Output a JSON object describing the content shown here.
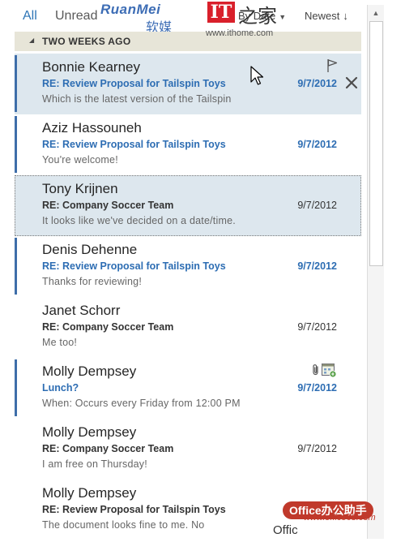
{
  "filters": {
    "all": "All",
    "unread": "Unread"
  },
  "sort": {
    "field": "By Date",
    "order": "Newest"
  },
  "group": {
    "label": "TWO WEEKS AGO"
  },
  "watermarks": {
    "ruanmei_en": "RuanMei",
    "ruanmei_cn": "软媒",
    "it_logo": "IT",
    "it_cn": "之家",
    "ithome_url": "www.ithome.com",
    "office_cn": "Office办公助手",
    "office_url": "www.office68.com",
    "office_label": "Offic"
  },
  "messages": [
    {
      "sender": "Bonnie Kearney",
      "subject": "RE: Review Proposal for Tailspin Toys",
      "date": "9/7/2012",
      "preview": "Which is the latest version of the Tailspin",
      "unread": true,
      "state": "selected",
      "icons": [
        "flag-icon",
        "close-icon"
      ]
    },
    {
      "sender": "Aziz Hassouneh",
      "subject": "RE: Review Proposal for Tailspin Toys",
      "date": "9/7/2012",
      "preview": "You're welcome!",
      "unread": true,
      "state": "",
      "icons": []
    },
    {
      "sender": "Tony Krijnen",
      "subject": "RE: Company Soccer Team",
      "date": "9/7/2012",
      "preview": "It looks like we've decided on a date/time.",
      "unread": false,
      "state": "focused",
      "icons": []
    },
    {
      "sender": "Denis Dehenne",
      "subject": "RE: Review Proposal for Tailspin Toys",
      "date": "9/7/2012",
      "preview": "Thanks for reviewing!",
      "unread": true,
      "state": "",
      "icons": []
    },
    {
      "sender": "Janet Schorr",
      "subject": "RE: Company Soccer Team",
      "date": "9/7/2012",
      "preview": "Me too!",
      "unread": false,
      "state": "",
      "icons": []
    },
    {
      "sender": "Molly Dempsey",
      "subject": "Lunch?",
      "date": "9/7/2012",
      "preview": "When: Occurs every Friday from 12:00 PM",
      "unread": true,
      "state": "",
      "icons": [
        "paperclip-icon",
        "meeting-icon"
      ]
    },
    {
      "sender": "Molly Dempsey",
      "subject": "RE: Company Soccer Team",
      "date": "9/7/2012",
      "preview": "I am free on Thursday!",
      "unread": false,
      "state": "",
      "icons": []
    },
    {
      "sender": "Molly Dempsey",
      "subject": "RE: Review Proposal for Tailspin Toys",
      "date": "",
      "preview": "The document looks fine to me. No",
      "unread": false,
      "state": "",
      "icons": []
    }
  ],
  "colors": {
    "accent": "#2e75b6",
    "unread_bar": "#3e6ea9",
    "selection": "#dde7ee",
    "group_header": "#e7e5d8"
  }
}
